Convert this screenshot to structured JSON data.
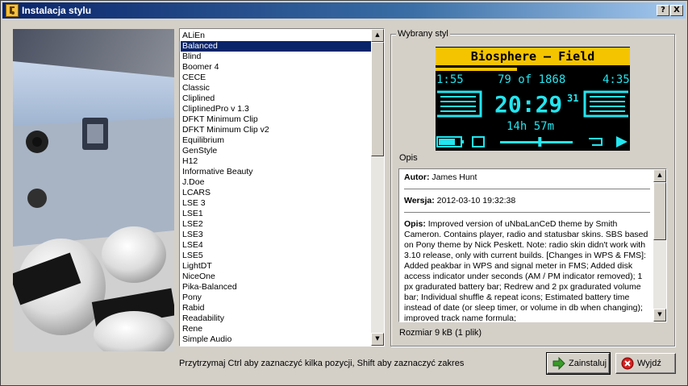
{
  "window": {
    "title": "Instalacja stylu",
    "help_label": "?",
    "close_label": "X"
  },
  "themes": {
    "items": [
      "ALiEn",
      "Balanced",
      "Blind",
      "Boomer 4",
      "CECE",
      "Classic",
      "Cliplined",
      "ClipIinedPro v 1.3",
      "DFKT Minimum Clip",
      "DFKT Minimum Clip v2",
      "Equilibrium",
      "GenStyle",
      "H12",
      "Informative Beauty",
      "J.Doe",
      "LCARS",
      "LSE 3",
      "LSE1",
      "LSE2",
      "LSE3",
      "LSE4",
      "LSE5",
      "LightDT",
      "NiceOne",
      "Pika-Balanced",
      "Pony",
      "Rabid",
      "Readability",
      "Rene",
      "Simple Audio"
    ],
    "selected": "Balanced"
  },
  "group": {
    "label": "Wybrany styl"
  },
  "preview": {
    "track_title": "Biosphere – Field",
    "elapsed": "1:55",
    "track_position": "79 of 1868",
    "total": "4:35",
    "clock": "20:29",
    "day": "31",
    "remaining": "14h 57m",
    "progress": 0.42,
    "volume": 0.55,
    "colors": {
      "accent": "#f5c400",
      "text": "#22e6f0",
      "background": "#000000"
    }
  },
  "description": {
    "section_label": "Opis",
    "author_key": "Autor:",
    "author_value": "James Hunt",
    "version_key": "Wersja:",
    "version_value": "2012-03-10 19:32:38",
    "desc_key": "Opis:",
    "desc_value": "Improved version of uNbaLanCeD theme by Smith Cameron. Contains player, radio and statusbar skins. SBS based on Pony theme by Nick Peskett. Note: radio skin didn't work with 3.10 release, only with current builds. [Changes in WPS & FMS]: Added peakbar in WPS and signal meter in FMS; Added disk access indicator under seconds (AM / PM indicator removed); 1 px gradurated battery bar; Redrew and 2 px gradurated volume bar; Individual shuffle & repeat icons; Estimated battery time instead of date (or sleep timer, or volume in db when changing); improved track name formula;"
  },
  "size_label": "Rozmiar 9 kB (1 plik)",
  "hint": "Przytrzymaj Ctrl aby zaznaczyć kilka pozycji, Shift aby zaznaczyć zakres",
  "buttons": {
    "install": "Zainstaluj",
    "exit": "Wyjdź"
  }
}
